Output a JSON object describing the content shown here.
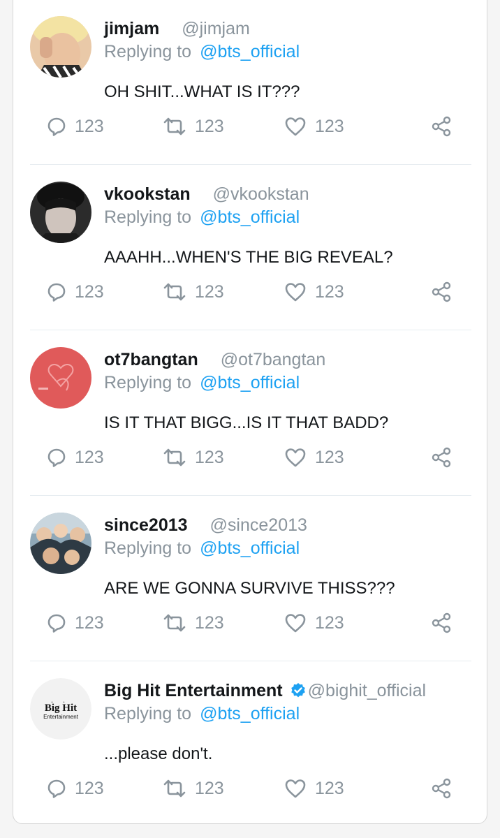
{
  "tweets": [
    {
      "name": "jimjam",
      "handle": "@jimjam",
      "replying_label": "Replying to",
      "replying_to": "@bts_official",
      "text": "OH SHIT...WHAT IS IT???",
      "counts": {
        "replies": "123",
        "retweets": "123",
        "likes": "123"
      },
      "avatar_icon": "user-photo-avatar",
      "verified": false
    },
    {
      "name": "vkookstan",
      "handle": "@vkookstan",
      "replying_label": "Replying to",
      "replying_to": "@bts_official",
      "text": "AAAHH...WHEN'S THE BIG REVEAL?",
      "counts": {
        "replies": "123",
        "retweets": "123",
        "likes": "123"
      },
      "avatar_icon": "user-photo-avatar",
      "verified": false
    },
    {
      "name": "ot7bangtan",
      "handle": "@ot7bangtan",
      "replying_label": "Replying to",
      "replying_to": "@bts_official",
      "text": "IS IT THAT BIGG...IS IT THAT BADD?",
      "counts": {
        "replies": "123",
        "retweets": "123",
        "likes": "123"
      },
      "avatar_icon": "album-art-avatar",
      "verified": false
    },
    {
      "name": "since2013",
      "handle": "@since2013",
      "replying_label": "Replying to",
      "replying_to": "@bts_official",
      "text": "ARE WE GONNA SURVIVE THISS???",
      "counts": {
        "replies": "123",
        "retweets": "123",
        "likes": "123"
      },
      "avatar_icon": "group-photo-avatar",
      "verified": false
    },
    {
      "name": "Big Hit Entertainment",
      "handle": "@bighit_official",
      "replying_label": "Replying to",
      "replying_to": "@bts_official",
      "text": "...please don't.",
      "counts": {
        "replies": "123",
        "retweets": "123",
        "likes": "123"
      },
      "avatar_icon": "big-hit-logo",
      "verified": true,
      "logo_text": {
        "line1": "Big Hit",
        "line2": "Entertainment"
      }
    }
  ],
  "colors": {
    "name": "#14171a",
    "muted": "#8a949c",
    "mention": "#1da1f2",
    "divider": "#e6ecf0",
    "verified": "#1da1f2"
  },
  "icons": {
    "reply": "reply-icon",
    "retweet": "retweet-icon",
    "like": "heart-icon",
    "share": "share-icon",
    "verified": "verified-badge-icon"
  }
}
